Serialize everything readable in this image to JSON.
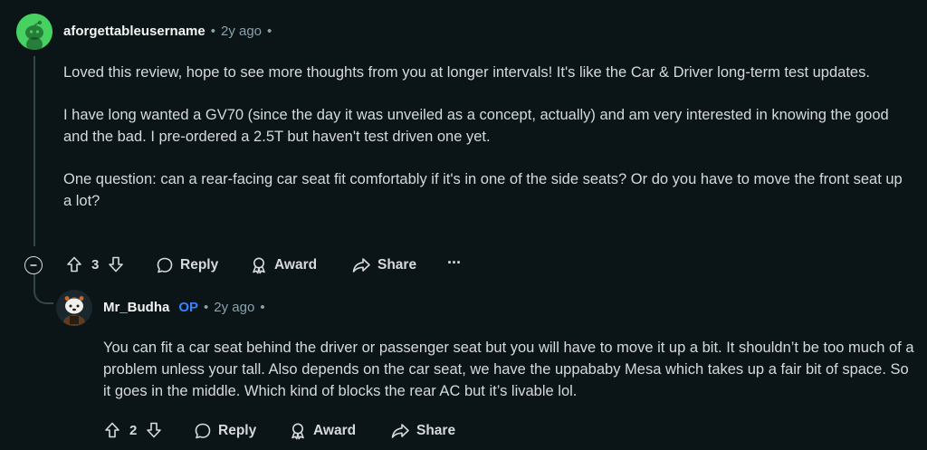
{
  "comment1": {
    "username": "aforgettableusername",
    "sep1": "•",
    "time": "2y ago",
    "sep2": "•",
    "paragraphs": [
      "Loved this review, hope to see more thoughts from you at longer intervals! It's like the Car & Driver long-term test updates.",
      "I have long wanted a GV70 (since the day it was unveiled as a concept, actually) and am very interested in knowing the good and the bad. I pre-ordered a 2.5T but haven't test driven one yet.",
      "One question: can a rear-facing car seat fit comfortably if it's in one of the side seats? Or do you have to move the front seat up a lot?"
    ],
    "votes": "3",
    "reply_label": "Reply",
    "award_label": "Award",
    "share_label": "Share",
    "more_label": "···"
  },
  "comment2": {
    "username": "Mr_Budha",
    "op_badge": "OP",
    "sep1": "•",
    "time": "2y ago",
    "sep2": "•",
    "paragraphs": [
      "You can fit a car seat behind the driver or passenger seat but you will have to move it up a bit. It shouldn’t be too much of a problem unless your tall. Also depends on the car seat, we have the uppababy Mesa which takes up a fair bit of space. So it goes in the middle. Which kind of blocks the rear AC but it’s livable lol."
    ],
    "votes": "2",
    "reply_label": "Reply",
    "award_label": "Award",
    "share_label": "Share"
  },
  "icons": {
    "avatar1": "snoo-avatar-green",
    "avatar2": "snoo-avatar-custom",
    "upvote": "arrow-up-icon",
    "downvote": "arrow-down-icon",
    "reply": "speech-bubble-icon",
    "award": "award-ribbon-icon",
    "share": "share-arrow-icon",
    "collapse": "minus-circle-icon"
  },
  "colors": {
    "background": "#0b1416",
    "text": "#d7dadc",
    "meta": "#8ba2ad",
    "op": "#3c82ff",
    "avatar1_bg": "#46d160"
  }
}
